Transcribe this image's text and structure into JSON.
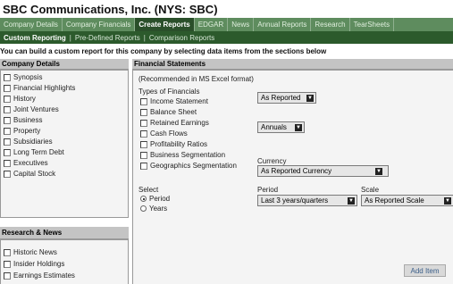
{
  "title": "SBC Communications, Inc. (NYS: SBC)",
  "tabs": [
    "Company Details",
    "Company Financials",
    "Create Reports",
    "EDGAR",
    "News",
    "Annual Reports",
    "Research",
    "TearSheets"
  ],
  "subnav": {
    "active": "Custom Reporting",
    "sep": "|",
    "items": [
      "Pre-Defined Reports",
      "Comparison Reports"
    ]
  },
  "intro": "You can build a custom report for this company by selecting data items from the sections below",
  "company_details": {
    "heading": "Company Details",
    "items": [
      "Synopsis",
      "Financial Highlights",
      "History",
      "Joint Ventures",
      "Business",
      "Property",
      "Subsidiaries",
      "Long Term Debt",
      "Executives",
      "Capital Stock"
    ]
  },
  "research_news": {
    "heading": "Research & News",
    "items": [
      "Historic News",
      "Insider Holdings",
      "Earnings Estimates"
    ]
  },
  "financial": {
    "heading": "Financial Statements",
    "note": "(Recommended in MS Excel format)",
    "types_label": "Types of Financials",
    "types": [
      "Income Statement",
      "Balance Sheet",
      "Retained Earnings",
      "Cash Flows",
      "Profitability Ratios",
      "Business Segmentation",
      "Geographics Segmentation"
    ],
    "reporting_select": "As Reported",
    "frequency_select": "Annuals",
    "currency_label": "Currency",
    "currency_select": "As Reported Currency",
    "select_label": "Select",
    "radio_period": "Period",
    "radio_years": "Years",
    "period_label": "Period",
    "period_select": "Last 3 years/quarters",
    "scale_label": "Scale",
    "scale_select": "As Reported Scale",
    "add_button": "Add Item"
  }
}
